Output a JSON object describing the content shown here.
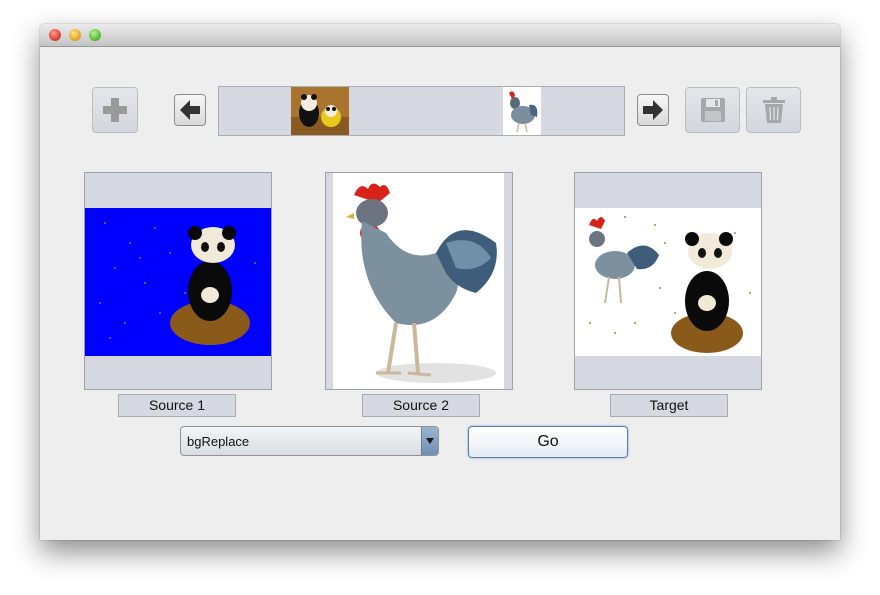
{
  "toolbar": {
    "add_icon": "plus-icon",
    "prev_icon": "arrow-left-icon",
    "next_icon": "arrow-right-icon",
    "save_icon": "floppy-disk-icon",
    "delete_icon": "trash-icon"
  },
  "panels": {
    "source1": {
      "label": "Source 1"
    },
    "source2": {
      "label": "Source 2"
    },
    "target": {
      "label": "Target"
    }
  },
  "operation": {
    "selected": "bgReplace"
  },
  "go": {
    "label": "Go"
  },
  "colors": {
    "source1_background": "#0000ff",
    "rooster_comb": "#d8231a"
  }
}
